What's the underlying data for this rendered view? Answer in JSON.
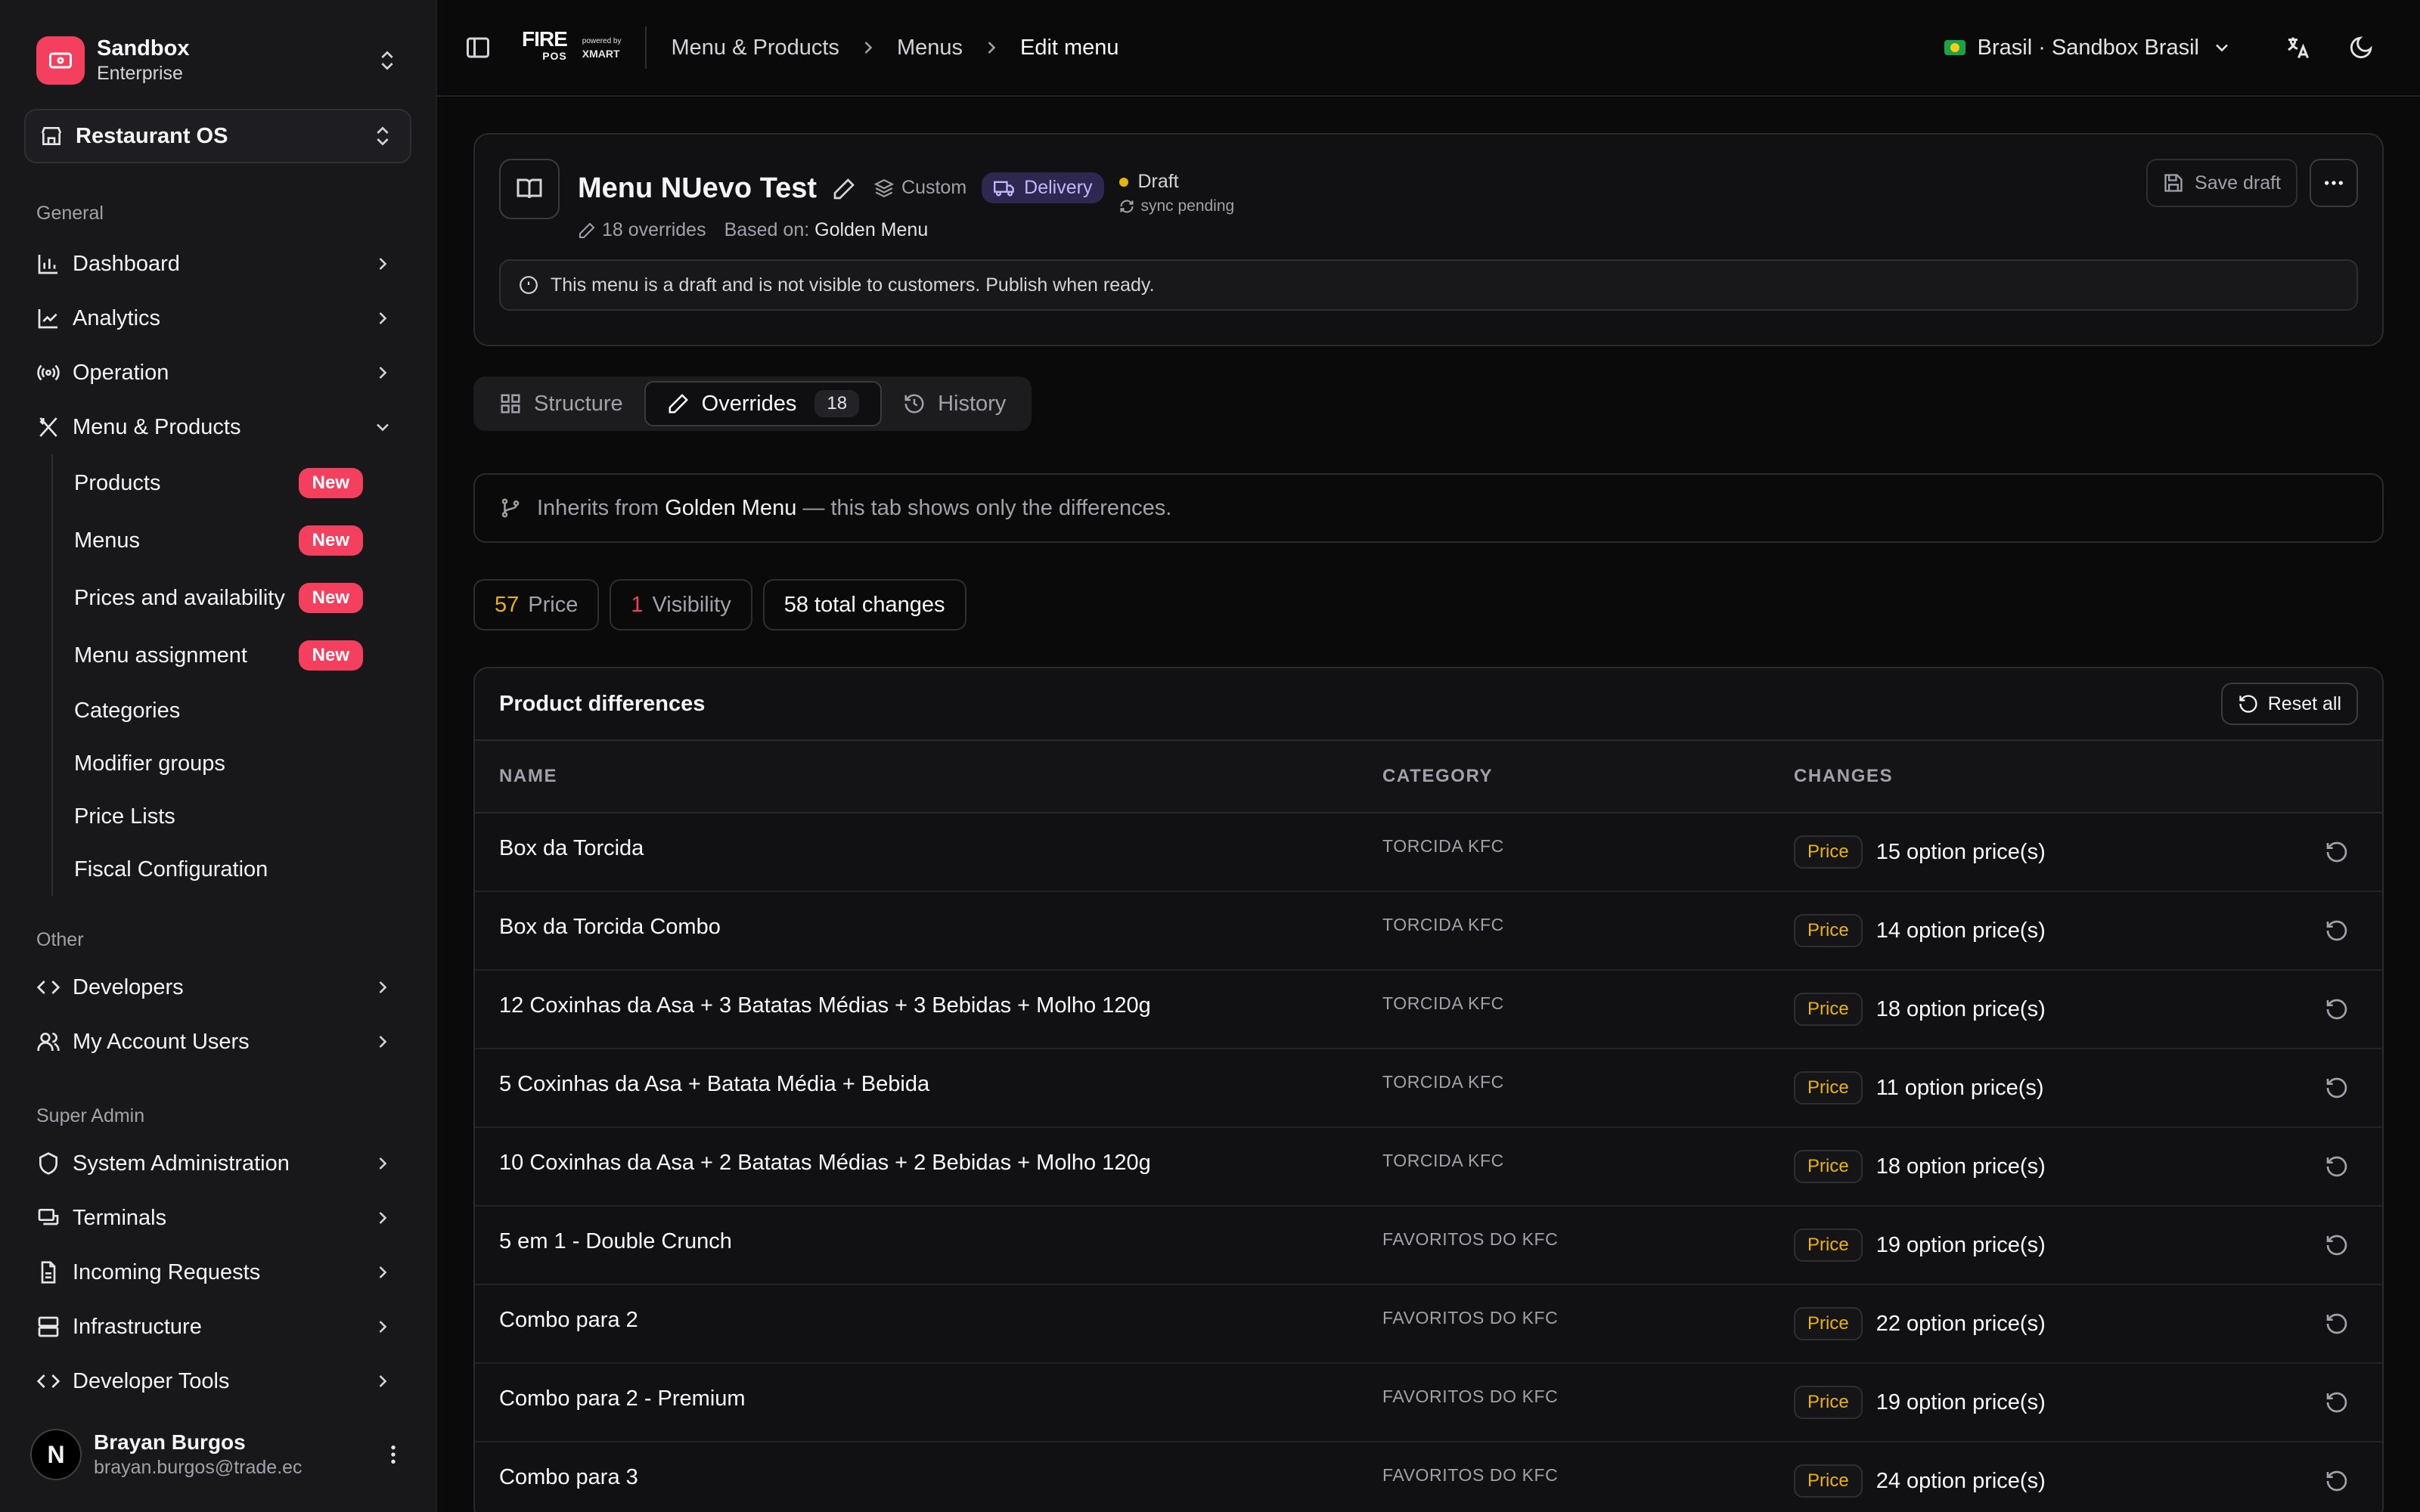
{
  "org": {
    "name": "Sandbox",
    "plan": "Enterprise"
  },
  "app_switcher": {
    "label": "Restaurant OS"
  },
  "sidebar": {
    "general_label": "General",
    "general_items": [
      {
        "label": "Dashboard",
        "icon": "bar-chart-icon"
      },
      {
        "label": "Analytics",
        "icon": "line-chart-icon"
      },
      {
        "label": "Operation",
        "icon": "radio-icon"
      }
    ],
    "menu_products": {
      "label": "Menu & Products",
      "sub": [
        {
          "label": "Products",
          "badge": "New"
        },
        {
          "label": "Menus",
          "badge": "New"
        },
        {
          "label": "Prices and availability",
          "badge": "New"
        },
        {
          "label": "Menu assignment",
          "badge": "New"
        },
        {
          "label": "Categories"
        },
        {
          "label": "Modifier groups"
        },
        {
          "label": "Price Lists"
        },
        {
          "label": "Fiscal Configuration"
        }
      ]
    },
    "other_label": "Other",
    "other_items": [
      {
        "label": "Developers"
      },
      {
        "label": "My Account Users"
      }
    ],
    "super_label": "Super Admin",
    "super_items": [
      {
        "label": "System Administration"
      },
      {
        "label": "Terminals"
      },
      {
        "label": "Incoming Requests"
      },
      {
        "label": "Infrastructure"
      },
      {
        "label": "Developer Tools"
      }
    ]
  },
  "user": {
    "name": "Brayan Burgos",
    "email": "brayan.burgos@trade.ec",
    "initial": "N"
  },
  "topbar": {
    "brand_fire": "FIRE",
    "brand_pos": "POS",
    "brand_powered": "powered by",
    "brand_xmart": "XMART",
    "breadcrumbs": [
      "Menu & Products",
      "Menus",
      "Edit menu"
    ],
    "region": "Brasil · Sandbox Brasil"
  },
  "menu": {
    "title": "Menu NUevo Test",
    "type": "Custom",
    "channel": "Delivery",
    "status": "Draft",
    "sync": "sync pending",
    "overrides": "18 overrides",
    "based_on_label": "Based on:",
    "based_on": "Golden Menu",
    "save_label": "Save draft",
    "alert": "This menu is a draft and is not visible to customers. Publish when ready."
  },
  "tabs": [
    {
      "label": "Structure"
    },
    {
      "label": "Overrides",
      "count": "18"
    },
    {
      "label": "History"
    }
  ],
  "inherit": {
    "prefix": "Inherits from",
    "source": "Golden Menu",
    "suffix": "— this tab shows only the differences."
  },
  "stats": {
    "price_n": "57",
    "price_label": "Price",
    "vis_n": "1",
    "vis_label": "Visibility",
    "total": "58 total changes"
  },
  "table": {
    "title": "Product differences",
    "reset_label": "Reset all",
    "headers": {
      "name": "NAME",
      "category": "CATEGORY",
      "changes": "CHANGES"
    },
    "rows": [
      {
        "name": "Box da Torcida",
        "category": "TORCIDA KFC",
        "tag": "Price",
        "change": "15 option price(s)"
      },
      {
        "name": "Box da Torcida Combo",
        "category": "TORCIDA KFC",
        "tag": "Price",
        "change": "14 option price(s)"
      },
      {
        "name": "12 Coxinhas da Asa + 3 Batatas Médias + 3 Bebidas + Molho 120g",
        "category": "TORCIDA KFC",
        "tag": "Price",
        "change": "18 option price(s)"
      },
      {
        "name": "5 Coxinhas da Asa + Batata Média + Bebida",
        "category": "TORCIDA KFC",
        "tag": "Price",
        "change": "11 option price(s)"
      },
      {
        "name": "10 Coxinhas da Asa + 2 Batatas Médias + 2 Bebidas + Molho 120g",
        "category": "TORCIDA KFC",
        "tag": "Price",
        "change": "18 option price(s)"
      },
      {
        "name": "5 em 1 - Double Crunch",
        "category": "FAVORITOS DO KFC",
        "tag": "Price",
        "change": "19 option price(s)"
      },
      {
        "name": "Combo para 2",
        "category": "FAVORITOS DO KFC",
        "tag": "Price",
        "change": "22 option price(s)"
      },
      {
        "name": "Combo para 2 - Premium",
        "category": "FAVORITOS DO KFC",
        "tag": "Price",
        "change": "19 option price(s)"
      },
      {
        "name": "Combo para 3",
        "category": "FAVORITOS DO KFC",
        "tag": "Price",
        "change": "24 option price(s)"
      }
    ]
  }
}
